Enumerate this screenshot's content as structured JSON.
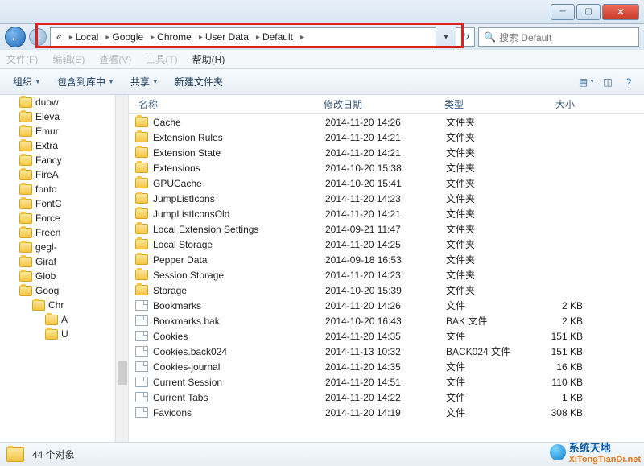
{
  "window": {
    "minimize": "─",
    "maximize": "▢",
    "close": "✕"
  },
  "breadcrumb": {
    "prefix": "«",
    "items": [
      "Local",
      "Google",
      "Chrome",
      "User Data",
      "Default"
    ]
  },
  "search": {
    "placeholder": "搜索 Default"
  },
  "menubar": [
    "文件(F)",
    "编辑(E)",
    "查看(V)",
    "工具(T)",
    "帮助(H)"
  ],
  "toolbar": {
    "organize": "组织",
    "include": "包含到库中",
    "share": "共享",
    "newfolder": "新建文件夹"
  },
  "tree": {
    "items": [
      "duow",
      "Eleva",
      "Emur",
      "Extra",
      "Fancy",
      "FireA",
      "fontc",
      "FontC",
      "Force",
      "Freen",
      "gegl-",
      "Giraf",
      "Glob",
      "Goog",
      "Chr",
      "A",
      "U"
    ]
  },
  "columns": {
    "name": "名称",
    "date": "修改日期",
    "type": "类型",
    "size": "大小"
  },
  "files": [
    {
      "icon": "folder",
      "name": "Cache",
      "date": "2014-11-20 14:26",
      "type": "文件夹",
      "size": ""
    },
    {
      "icon": "folder",
      "name": "Extension Rules",
      "date": "2014-11-20 14:21",
      "type": "文件夹",
      "size": ""
    },
    {
      "icon": "folder",
      "name": "Extension State",
      "date": "2014-11-20 14:21",
      "type": "文件夹",
      "size": ""
    },
    {
      "icon": "folder",
      "name": "Extensions",
      "date": "2014-10-20 15:38",
      "type": "文件夹",
      "size": ""
    },
    {
      "icon": "folder",
      "name": "GPUCache",
      "date": "2014-10-20 15:41",
      "type": "文件夹",
      "size": ""
    },
    {
      "icon": "folder",
      "name": "JumpListIcons",
      "date": "2014-11-20 14:23",
      "type": "文件夹",
      "size": ""
    },
    {
      "icon": "folder",
      "name": "JumpListIconsOld",
      "date": "2014-11-20 14:21",
      "type": "文件夹",
      "size": ""
    },
    {
      "icon": "folder",
      "name": "Local Extension Settings",
      "date": "2014-09-21 11:47",
      "type": "文件夹",
      "size": ""
    },
    {
      "icon": "folder",
      "name": "Local Storage",
      "date": "2014-11-20 14:25",
      "type": "文件夹",
      "size": ""
    },
    {
      "icon": "folder",
      "name": "Pepper Data",
      "date": "2014-09-18 16:53",
      "type": "文件夹",
      "size": ""
    },
    {
      "icon": "folder",
      "name": "Session Storage",
      "date": "2014-11-20 14:23",
      "type": "文件夹",
      "size": ""
    },
    {
      "icon": "folder",
      "name": "Storage",
      "date": "2014-10-20 15:39",
      "type": "文件夹",
      "size": ""
    },
    {
      "icon": "file",
      "name": "Bookmarks",
      "date": "2014-11-20 14:26",
      "type": "文件",
      "size": "2 KB"
    },
    {
      "icon": "file",
      "name": "Bookmarks.bak",
      "date": "2014-10-20 16:43",
      "type": "BAK 文件",
      "size": "2 KB"
    },
    {
      "icon": "file",
      "name": "Cookies",
      "date": "2014-11-20 14:35",
      "type": "文件",
      "size": "151 KB"
    },
    {
      "icon": "file",
      "name": "Cookies.back024",
      "date": "2014-11-13 10:32",
      "type": "BACK024 文件",
      "size": "151 KB"
    },
    {
      "icon": "file",
      "name": "Cookies-journal",
      "date": "2014-11-20 14:35",
      "type": "文件",
      "size": "16 KB"
    },
    {
      "icon": "file",
      "name": "Current Session",
      "date": "2014-11-20 14:51",
      "type": "文件",
      "size": "110 KB"
    },
    {
      "icon": "file",
      "name": "Current Tabs",
      "date": "2014-11-20 14:22",
      "type": "文件",
      "size": "1 KB"
    },
    {
      "icon": "file",
      "name": "Favicons",
      "date": "2014-11-20 14:19",
      "type": "文件",
      "size": "308 KB"
    }
  ],
  "statusbar": {
    "count": "44 个对象"
  },
  "watermark": {
    "line1": "系统天地",
    "line2": "XiTongTianDi.net"
  }
}
